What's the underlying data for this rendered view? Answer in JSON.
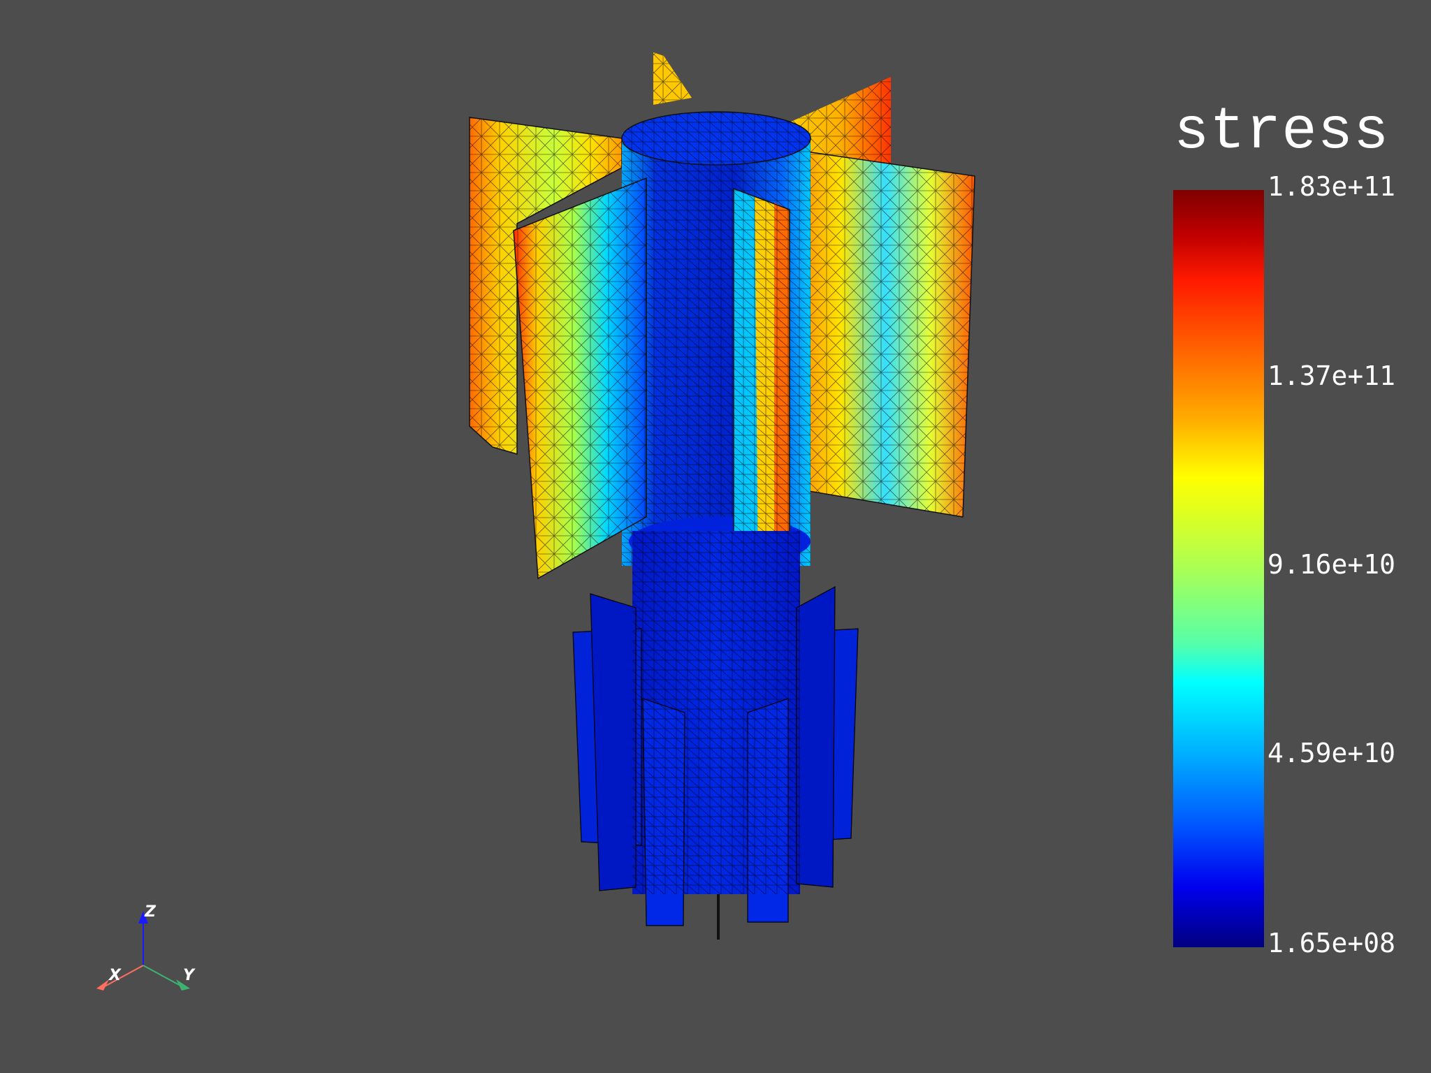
{
  "scalar_bar": {
    "title": "stress",
    "labels": [
      "1.83e+11",
      "1.37e+11",
      "9.16e+10",
      "4.59e+10",
      "1.65e+08"
    ],
    "range": [
      165000000.0,
      183000000000.0
    ],
    "colormap": "jet"
  },
  "orientation_axes": {
    "x_label": "X",
    "y_label": "Y",
    "z_label": "Z",
    "x_color": "#ff6f61",
    "y_color": "#3cb371",
    "z_color": "#1a1aff"
  },
  "background_color": "#4d4d4d",
  "mesh_colors": {
    "low": "#0022dd",
    "mid": "#00e5ff",
    "high_mid": "#e6ff33",
    "high": "#ffaa00",
    "peak": "#ff3300"
  }
}
